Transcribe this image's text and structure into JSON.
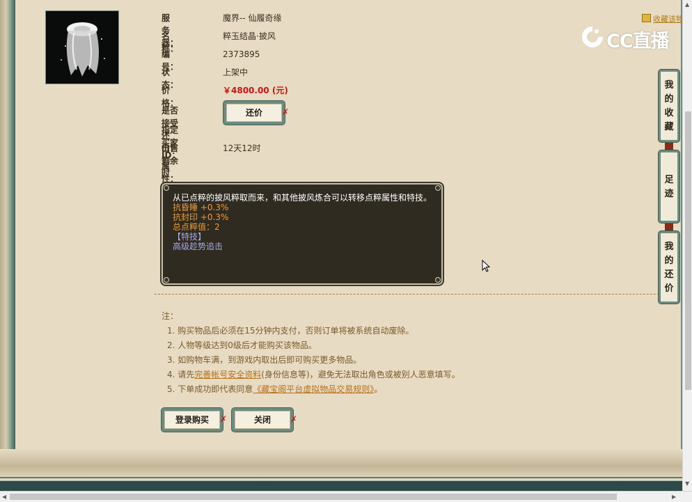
{
  "header": {
    "favorite_link": "收藏该物",
    "watermark": "CC直播"
  },
  "item": {
    "fields": [
      {
        "label": "服 务 器：",
        "value": "魔界-- 仙履奇缘"
      },
      {
        "label": "名　　称：",
        "value": "粹玉结晶·披风"
      },
      {
        "label": "编　　号：",
        "value": "2373895"
      },
      {
        "label": "状　　态：",
        "value": "上架中"
      },
      {
        "label": "价　　格：",
        "value": "￥4800.00 (元)"
      }
    ],
    "counter_offer_label": "是否接受还价：",
    "counter_offer_button": "还价",
    "buyer_id_label": "指定买家 ID：",
    "time_left_label": "出售剩余时间：",
    "time_left_value": "12天12时",
    "attributes_label": "属性："
  },
  "description": {
    "main": "从已点粹的披风粹取而来，和其他披风炼合可以转移点粹属性和特技。",
    "attrs": [
      "抗昏睡 +0.3%",
      "抗封印 +0.3%",
      "总点粹值：2"
    ],
    "skill_header": "【特技】",
    "skill": "高级趁势追击"
  },
  "notes": {
    "title": "注：",
    "item1": "1. 购买物品后必须在15分钟内支付，否则订单将被系统自动废除。",
    "item2": "2. 人物等级达到0级后才能购买该物品。",
    "item3": "3. 如购物车满，到游戏内取出后即可购买更多物品。",
    "item4_pre": "4. 请先",
    "item4_link": "完善帐号安全资料",
    "item4_post": "(身份信息等)，避免无法取出角色或被别人恶意填写。",
    "item5_pre": "5. 下单成功即代表同意",
    "item5_link": "《藏宝阁平台虚拟物品交易规则》",
    "item5_post": "。"
  },
  "actions": {
    "buy": "登录购买",
    "close": "关闭"
  },
  "sidebar": {
    "favorites": [
      "我",
      "的",
      "收",
      "藏"
    ],
    "history": [
      "足",
      "迹"
    ],
    "offers": [
      "我",
      "的",
      "还",
      "价"
    ]
  },
  "colors": {
    "price": "#c81414",
    "attr": "#f09a38",
    "skill": "#a8a8e8",
    "frame": "#6f8c80"
  }
}
